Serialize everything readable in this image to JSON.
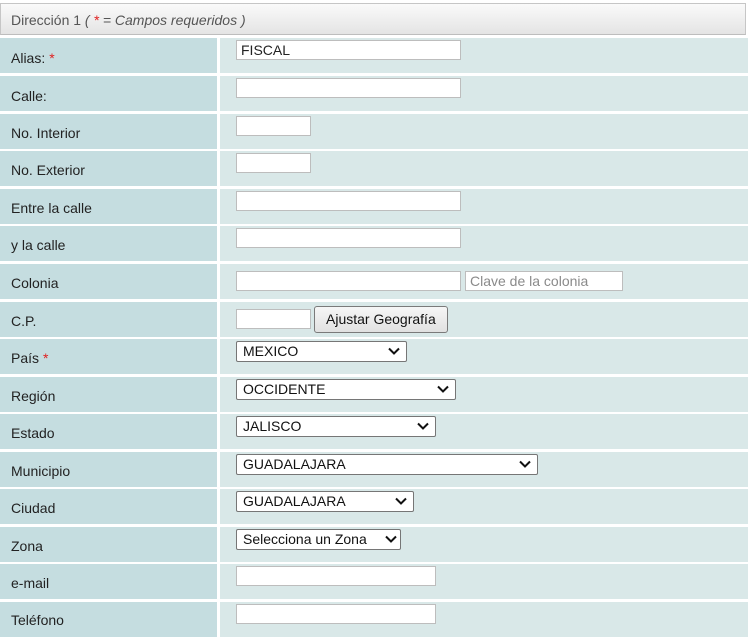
{
  "header": {
    "title": "Dirección 1",
    "note_open": "(",
    "note_star": "*",
    "note_text": "= Campos requeridos )"
  },
  "fields": {
    "alias": {
      "label": "Alias:",
      "required_mark": "*",
      "value": "FISCAL"
    },
    "calle": {
      "label": "Calle:",
      "value": ""
    },
    "no_interior": {
      "label": "No. Interior",
      "value": ""
    },
    "no_exterior": {
      "label": "No. Exterior",
      "value": ""
    },
    "entre_calle": {
      "label": "Entre la calle",
      "value": ""
    },
    "y_calle": {
      "label": "y la calle",
      "value": ""
    },
    "colonia": {
      "label": "Colonia",
      "value": "",
      "clave_placeholder": "Clave de la colonia"
    },
    "cp": {
      "label": "C.P.",
      "value": "",
      "button_label": "Ajustar Geografía"
    },
    "pais": {
      "label": "País",
      "required_mark": "*",
      "selected": "MEXICO"
    },
    "region": {
      "label": "Región",
      "selected": "OCCIDENTE"
    },
    "estado": {
      "label": "Estado",
      "selected": "JALISCO"
    },
    "municipio": {
      "label": "Municipio",
      "selected": "GUADALAJARA"
    },
    "ciudad": {
      "label": "Ciudad",
      "selected": "GUADALAJARA"
    },
    "zona": {
      "label": "Zona",
      "selected": "Selecciona un Zona"
    },
    "email": {
      "label": "e-mail",
      "value": ""
    },
    "telefono": {
      "label": "Teléfono",
      "value": ""
    }
  },
  "colors": {
    "label_bg": "#c5dde0",
    "value_bg": "#d9e8e8",
    "required": "#e02020"
  },
  "icons": {
    "dropdown": "chevron-down-icon"
  }
}
